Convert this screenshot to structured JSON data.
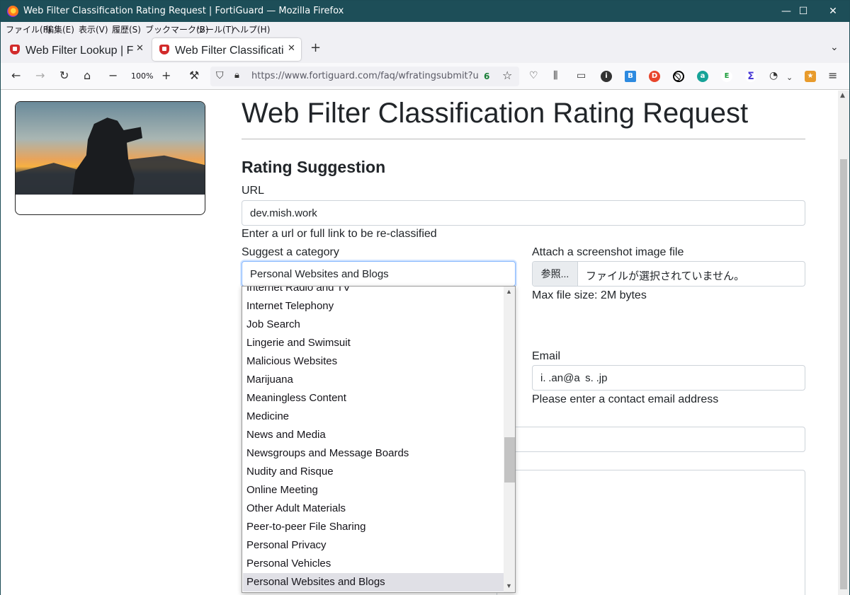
{
  "window": {
    "title": "Web Filter Classification Rating Request | FortiGuard — Mozilla Firefox",
    "minimize": "—",
    "maximize": "☐",
    "close": "✕"
  },
  "menu": [
    "ファイル(F)",
    "編集(E)",
    "表示(V)",
    "履歴(S)",
    "ブックマーク(B)",
    "ツール(T)",
    "ヘルプ(H)"
  ],
  "tabs": [
    {
      "label": "Web Filter Lookup | FortiGuard",
      "active": false
    },
    {
      "label": "Web Filter Classification Rating",
      "active": true
    }
  ],
  "toolbar": {
    "zoom": "100%",
    "url": "https://www.fortiguard.com/faq/wfratingsubmit?url=de"
  },
  "page": {
    "title": "Web Filter Classification Rating Request",
    "section": "Rating Suggestion",
    "url_label": "URL",
    "url_value": "dev.mish.work",
    "url_help": "Enter a url or full link to be re-classified",
    "category_label": "Suggest a category",
    "category_value": "Personal Websites and Blogs",
    "attach_label": "Attach a screenshot image file",
    "browse_label": "参照...",
    "no_file": "ファイルが選択されていません。",
    "max_size": "Max file size: 2M bytes",
    "email_label": "Email",
    "email_value": "i. .an@a  s. .jp",
    "email_help": "Please enter a contact email address"
  },
  "category_options": [
    "Internet Radio and TV",
    "Internet Telephony",
    "Job Search",
    "Lingerie and Swimsuit",
    "Malicious Websites",
    "Marijuana",
    "Meaningless Content",
    "Medicine",
    "News and Media",
    "Newsgroups and Message Boards",
    "Nudity and Risque",
    "Online Meeting",
    "Other Adult Materials",
    "Peer-to-peer File Sharing",
    "Personal Privacy",
    "Personal Vehicles",
    "Personal Websites and Blogs"
  ],
  "selected_option_index": 16,
  "colors": {
    "titlebar": "#1d4e58",
    "tab_bg": "#f0f0f4",
    "selected_option": "#e0e0e6",
    "focus_border": "#86b7fe"
  }
}
